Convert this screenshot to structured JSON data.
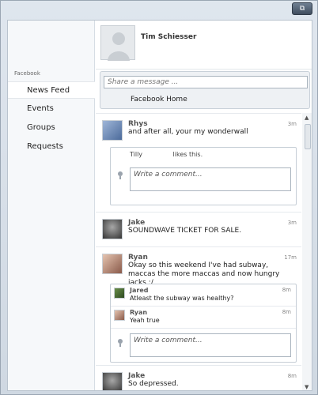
{
  "window": {
    "restore_icon": "restore-window-icon"
  },
  "sidebar": {
    "heading": "Facebook",
    "items": [
      {
        "label": "News Feed",
        "active": true
      },
      {
        "label": "Events",
        "active": false
      },
      {
        "label": "Groups",
        "active": false
      },
      {
        "label": "Requests",
        "active": false
      }
    ]
  },
  "profile": {
    "name": "Tim Schiesser"
  },
  "share": {
    "placeholder": "Share a message ...",
    "target": "Facebook Home"
  },
  "posts": [
    {
      "author": "Rhys",
      "time": "3m",
      "text": "and after all, your my wonderwall",
      "likes": {
        "liker": "Tilly",
        "suffix": "likes this."
      },
      "comment_placeholder": "Write a comment..."
    },
    {
      "author": "Jake",
      "time": "3m",
      "text": "SOUNDWAVE TICKET FOR SALE."
    },
    {
      "author": "Ryan",
      "time": "17m",
      "text": "Okay so this weekend I've had subway, maccas the more maccas and now hungry jacks :/",
      "comments": [
        {
          "author": "Jared",
          "time": "8m",
          "text": "Atleast the subway was healthy?"
        },
        {
          "author": "Ryan",
          "time": "8m",
          "text": "Yeah true"
        }
      ],
      "comment_placeholder": "Write a comment..."
    },
    {
      "author": "Jake",
      "time": "8m",
      "text": "So depressed."
    }
  ]
}
